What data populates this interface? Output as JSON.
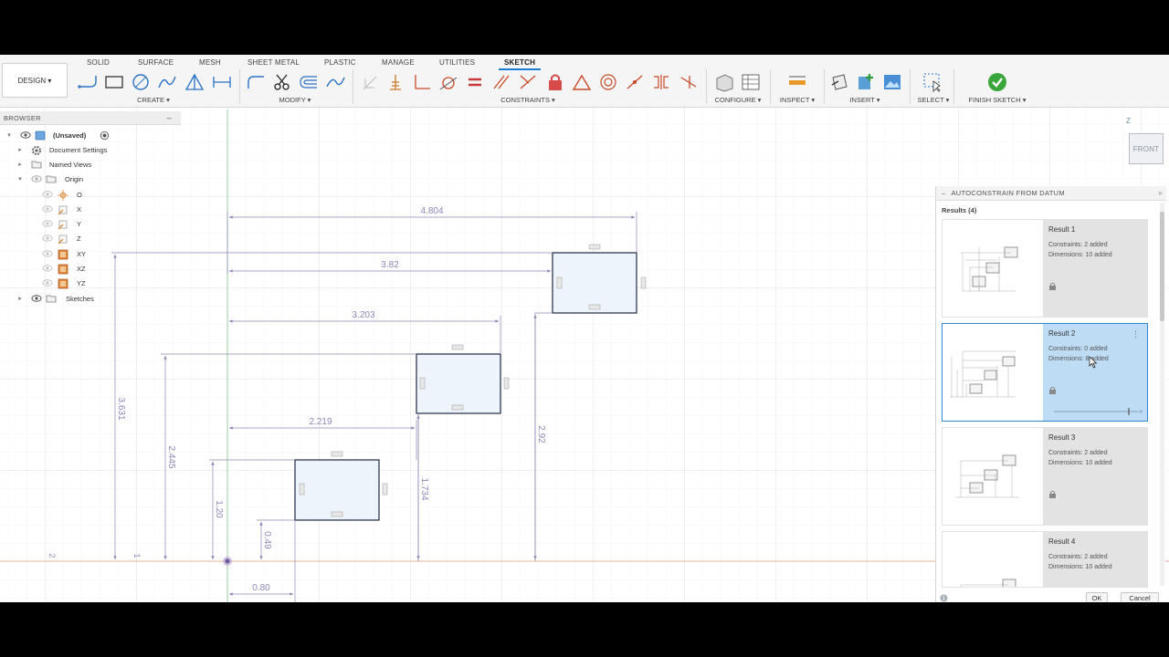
{
  "toolbar": {
    "tabs": [
      {
        "label": "SOLID",
        "active": false
      },
      {
        "label": "SURFACE",
        "active": false
      },
      {
        "label": "MESH",
        "active": false
      },
      {
        "label": "SHEET METAL",
        "active": false
      },
      {
        "label": "PLASTIC",
        "active": false
      },
      {
        "label": "MANAGE",
        "active": false
      },
      {
        "label": "UTILITIES",
        "active": false
      },
      {
        "label": "SKETCH",
        "active": true
      }
    ],
    "design_label": "DESIGN ▾",
    "groups": {
      "create": "CREATE ▾",
      "modify": "MODIFY ▾",
      "constraints": "CONSTRAINTS ▾",
      "configure": "CONFIGURE ▾",
      "inspect": "INSPECT ▾",
      "insert": "INSERT ▾",
      "select": "SELECT ▾",
      "finish": "FINISH SKETCH ▾"
    }
  },
  "browser": {
    "title": "BROWSER",
    "collapse": "–",
    "items": [
      {
        "label": "(Unsaved)",
        "icon": "component-icon"
      },
      {
        "label": "Document Settings",
        "icon": "gear-icon"
      },
      {
        "label": "Named Views",
        "icon": "folder-icon"
      },
      {
        "label": "Origin",
        "icon": "folder-icon"
      },
      {
        "label": "O",
        "icon": "origin-point-icon"
      },
      {
        "label": "X",
        "icon": "axis-icon"
      },
      {
        "label": "Y",
        "icon": "axis-icon"
      },
      {
        "label": "Z",
        "icon": "axis-icon"
      },
      {
        "label": "XY",
        "icon": "plane-icon"
      },
      {
        "label": "XZ",
        "icon": "plane-icon"
      },
      {
        "label": "YZ",
        "icon": "plane-icon"
      },
      {
        "label": "Sketches",
        "icon": "folder-icon"
      }
    ]
  },
  "viewcube": {
    "face": "FRONT",
    "axis": "Z"
  },
  "sketch": {
    "dimensions": {
      "d4804": "4.804",
      "d382": "3.82",
      "d3203": "3.203",
      "d2219": "2.219",
      "d3631": "3.631",
      "d2445": "2.445",
      "d120": "1.20",
      "d049": "0.49",
      "d080": "0.80",
      "d1734": "1.734",
      "d292": "2.92",
      "d2": "2",
      "d1": "1"
    }
  },
  "autoconstrain": {
    "title": "AUTOCONSTRAIN FROM DATUM",
    "results_count": "Results (4)",
    "results": [
      {
        "title": "Result 1",
        "constraints": "Constraints: 2 added",
        "dimensions": "Dimensions: 10 added",
        "selected": false
      },
      {
        "title": "Result 2",
        "constraints": "Constraints: 0 added",
        "dimensions": "Dimensions: 8 added",
        "selected": true
      },
      {
        "title": "Result 3",
        "constraints": "Constraints: 2 added",
        "dimensions": "Dimensions: 10 added",
        "selected": false
      },
      {
        "title": "Result 4",
        "constraints": "Constraints: 2 added",
        "dimensions": "Dimensions: 10 added",
        "selected": false
      }
    ],
    "ok": "OK",
    "cancel": "Cancel"
  },
  "colors": {
    "accent": "#1b7ed6",
    "dimension": "#8e86b8",
    "sketch_line": "#1f2a44",
    "rect_fill": "#eef4fb",
    "selected_card": "#bfdcf5"
  }
}
